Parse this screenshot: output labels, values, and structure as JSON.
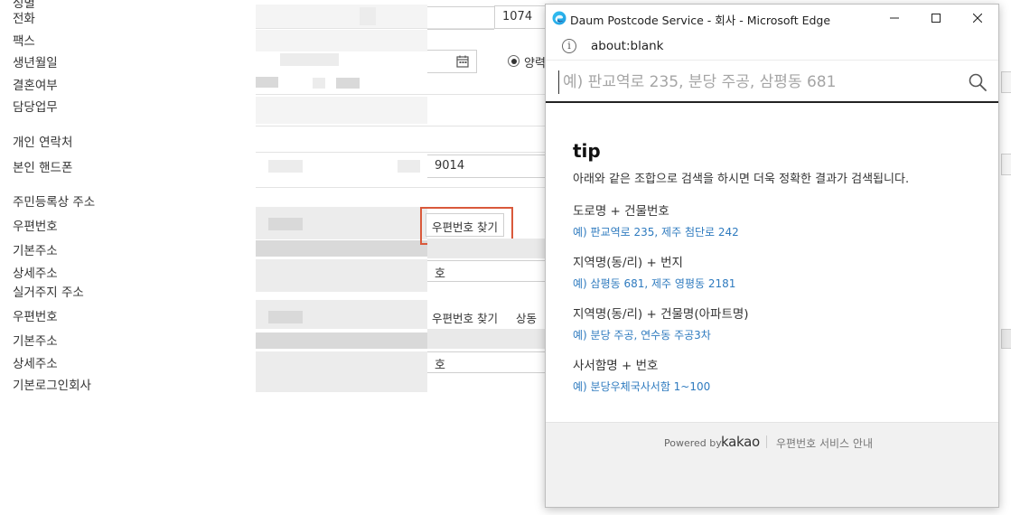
{
  "form": {
    "labels": {
      "top_cut": "성별",
      "phone": "전화",
      "fax": "팩스",
      "birth": "생년월일",
      "marriage": "결혼여부",
      "duty": "담당업무",
      "personal_contact": "개인 연락처",
      "mobile": "본인 핸드폰",
      "registered_address": "주민등록상 주소",
      "postcode_1": "우편번호",
      "address_1": "기본주소",
      "detail_1": "상세주소",
      "residence_address": "실거주지 주소",
      "postcode_2": "우편번호",
      "address_2": "기본주소",
      "detail_2": "상세주소",
      "default_company": "기본로그인회사"
    },
    "phone_ext": "1074",
    "calendar_radio": "양력",
    "mobile_tail": "9014",
    "find_postcode_1": "우편번호 찾기",
    "find_postcode_2": "우편번호 찾기",
    "same_as": "상동",
    "detail_1_suffix": "호",
    "detail_2_suffix": "호"
  },
  "popup": {
    "window_title": "Daum Postcode Service - 회사 - Microsoft Edge",
    "url": "about:blank",
    "search": {
      "placeholder": "예) 판교역로 235, 분당 주공, 삼평동 681",
      "icon": "search-icon"
    },
    "tip": {
      "title": "tip",
      "description": "아래와 같은 조합으로 검색을 하시면 더욱 정확한 결과가 검색됩니다.",
      "items": [
        {
          "heading": "도로명 + 건물번호",
          "example": "예) 판교역로 235,  제주 첨단로 242"
        },
        {
          "heading": "지역명(동/리) + 번지",
          "example": "예) 삼평동 681,  제주 영평동 2181"
        },
        {
          "heading": "지역명(동/리) + 건물명(아파트명)",
          "example": "예) 분당 주공,  연수동 주공3차"
        },
        {
          "heading": "사서함명 + 번호",
          "example": "예) 분당우체국사서함 1~100"
        }
      ]
    },
    "footer": {
      "powered_by": "Powered by",
      "brand": "kakao",
      "service_info": "우편번호 서비스 안내"
    },
    "colors": {
      "link": "#2f7bbf",
      "highlight": "#d9593b",
      "footer_bg": "#f1f1f1"
    }
  }
}
